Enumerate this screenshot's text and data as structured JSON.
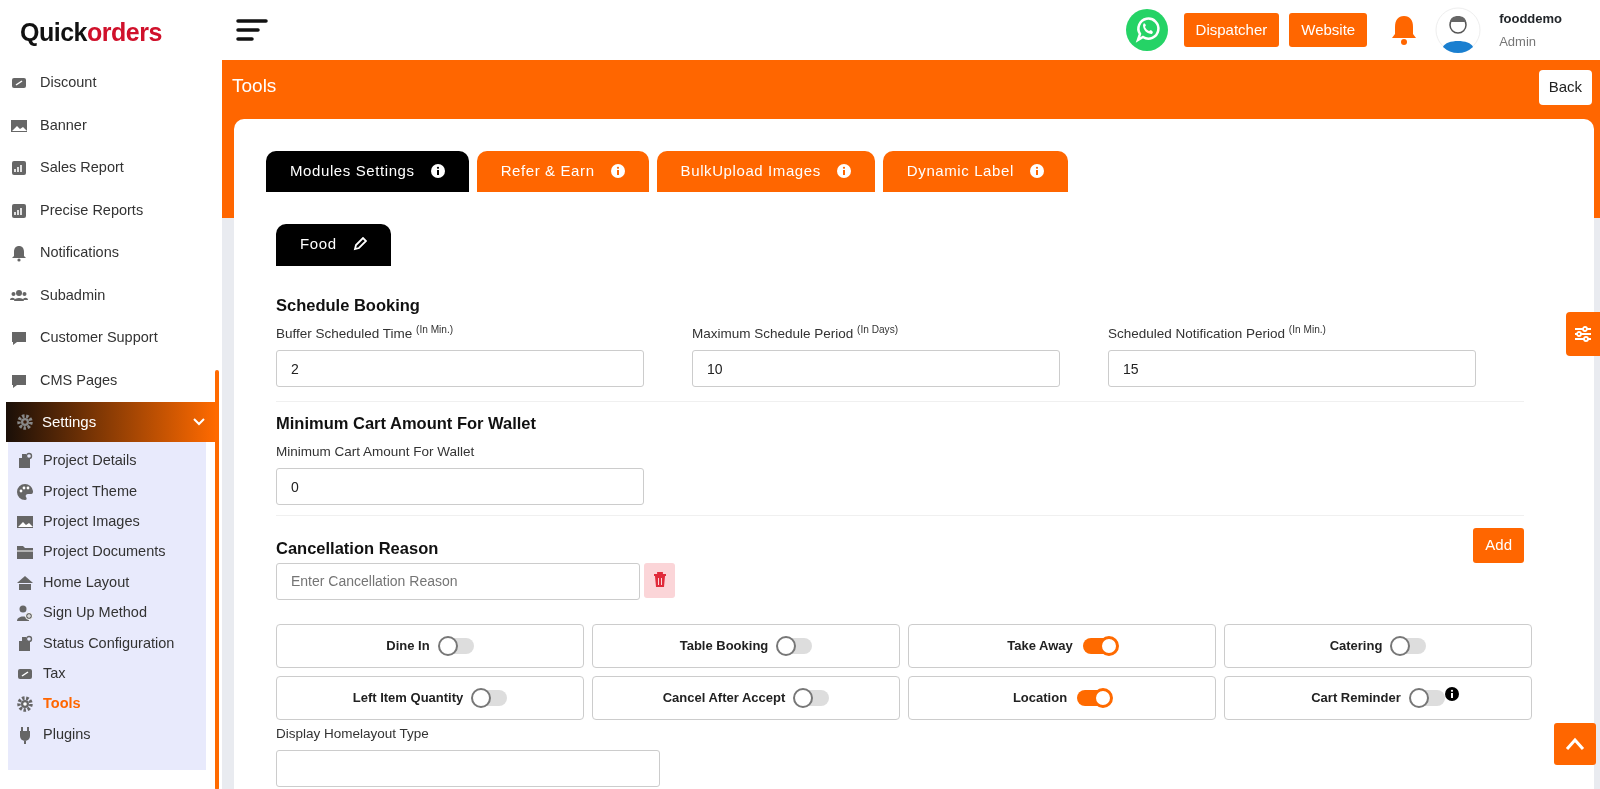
{
  "logo": {
    "part_a": "Quick",
    "part_b": "orders"
  },
  "sidebar": {
    "items": [
      {
        "label": "Discount",
        "selected": false
      },
      {
        "label": "Banner",
        "selected": false
      },
      {
        "label": "Sales Report",
        "selected": false
      },
      {
        "label": "Precise Reports",
        "selected": false
      },
      {
        "label": "Notifications",
        "selected": false
      },
      {
        "label": "Subadmin",
        "selected": false
      },
      {
        "label": "Customer Support",
        "selected": false
      },
      {
        "label": "CMS Pages",
        "selected": false
      },
      {
        "label": "Settings",
        "selected": false,
        "expanded": true,
        "children": [
          {
            "label": "Project Details",
            "selected": false
          },
          {
            "label": "Project Theme",
            "selected": false
          },
          {
            "label": "Project Images",
            "selected": false
          },
          {
            "label": "Project Documents",
            "selected": false
          },
          {
            "label": "Home Layout",
            "selected": false
          },
          {
            "label": "Sign Up Method",
            "selected": false
          },
          {
            "label": "Status Configuration",
            "selected": false
          },
          {
            "label": "Tax",
            "selected": false
          },
          {
            "label": "Tools",
            "selected": true
          },
          {
            "label": "Plugins",
            "selected": false
          }
        ]
      }
    ]
  },
  "header": {
    "buttons": [
      "Dispatcher",
      "Website"
    ],
    "user": {
      "name": "fooddemo",
      "role": "Admin"
    }
  },
  "page": {
    "title": "Tools",
    "back": "Back"
  },
  "tabs": [
    {
      "label": "Modules Settings",
      "selected": true
    },
    {
      "label": "Refer & Earn",
      "selected": false
    },
    {
      "label": "BulkUpload Images",
      "selected": false
    },
    {
      "label": "Dynamic Label",
      "selected": false
    }
  ],
  "module_tabs": [
    {
      "label": "Food",
      "selected": true
    }
  ],
  "schedule_booking": {
    "title": "Schedule Booking",
    "fields": [
      {
        "label": "Buffer Scheduled Time $^{(In Min.)}$",
        "value": "2"
      },
      {
        "label": "Maximum Schedule Period $^{(In Days)}$",
        "value": "10"
      },
      {
        "label": "Scheduled Notification Period $^{(In Min.)}$",
        "value": "15"
      }
    ]
  },
  "min_cart": {
    "title": "Minimum Cart Amount For Wallet",
    "fields": [
      {
        "label": "Minimum Cart Amount For Wallet",
        "value": "0"
      }
    ]
  },
  "cancellation": {
    "title": "Cancellation Reason",
    "add": "Add",
    "placeholder": "Enter Cancellation Reason"
  },
  "toggles": [
    {
      "label": "Dine In",
      "on": false
    },
    {
      "label": "Table Booking",
      "on": false
    },
    {
      "label": "Take Away",
      "on": true
    },
    {
      "label": "Catering",
      "on": false
    },
    {
      "label": "Left Item Quantity",
      "on": false
    },
    {
      "label": "Cancel After Accept",
      "on": false
    },
    {
      "label": "Location",
      "on": true
    },
    {
      "label": "Cart Reminder",
      "on": false,
      "info": true
    }
  ],
  "display_label": "Display Homelayout Type"
}
